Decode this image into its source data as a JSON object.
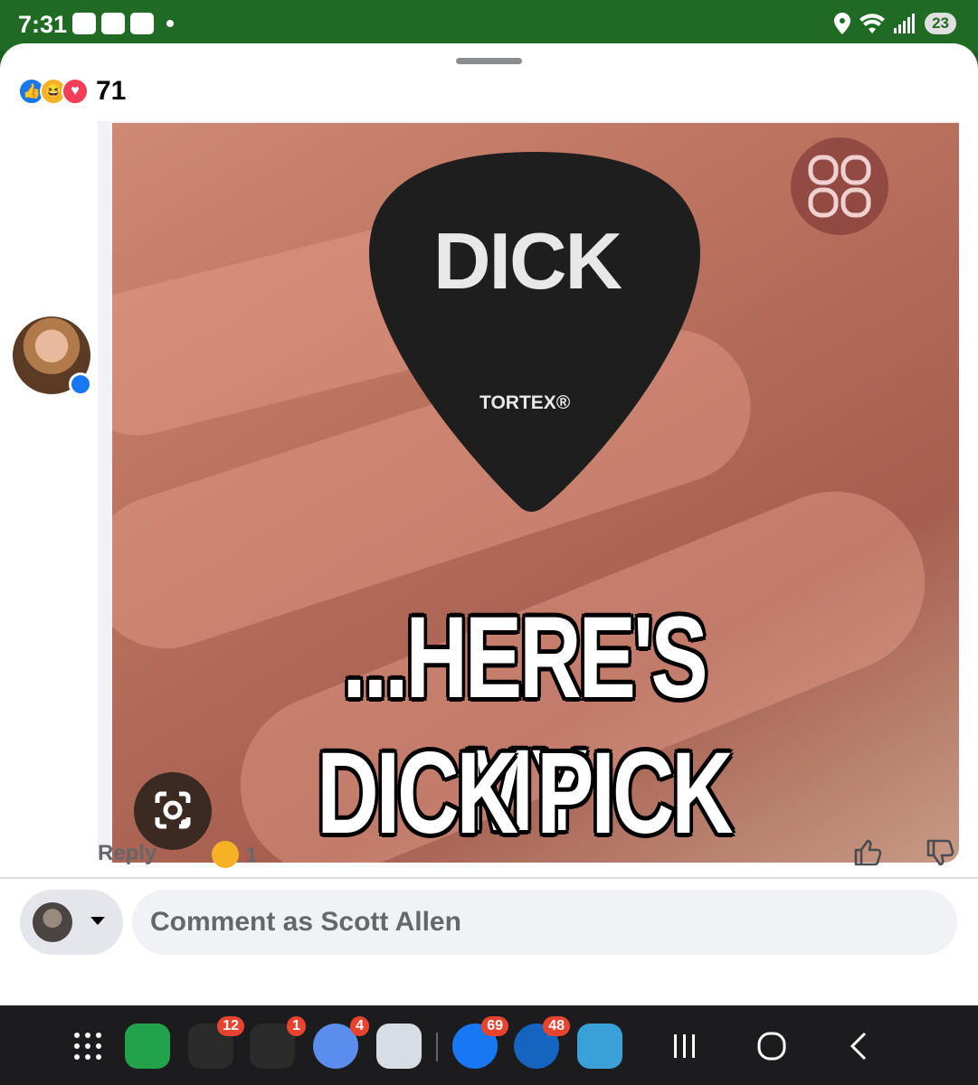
{
  "status_bar": {
    "time": "7:31",
    "battery": "23"
  },
  "post": {
    "reaction_count": "71",
    "reactions": [
      "like",
      "haha",
      "love"
    ]
  },
  "comment": {
    "image_text": {
      "pick_word": "DICK",
      "pick_brand": "TORTEX®",
      "caption_line1": "...HERE'S MY",
      "caption_line2": "DICK PICK"
    },
    "reply_label": "Reply",
    "haha_count": "1"
  },
  "composer": {
    "placeholder": "Comment as Scott Allen"
  },
  "nav": {
    "badges": {
      "phone_group": "12",
      "social_group": "1",
      "messages": "4",
      "facebook": "69",
      "adt": "48"
    }
  },
  "colors": {
    "status_bar": "#1f6b24",
    "facebook_blue": "#1877f2",
    "haha_yellow": "#f7b125",
    "love_red": "#f33e58"
  }
}
